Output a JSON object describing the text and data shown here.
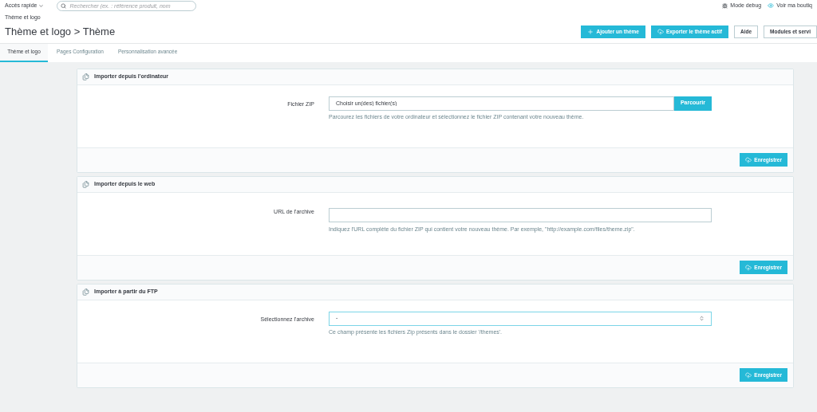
{
  "topbar": {
    "quick_access": "Accès rapide",
    "search_placeholder": "Rechercher (ex. : référence produit, nom",
    "debug": "Mode debug",
    "shop": "Voir ma boutiq"
  },
  "breadcrumb": "Thème et logo",
  "title": "Thème et logo > Thème",
  "actions": [
    {
      "label": "Ajouter un thème",
      "kind": "add"
    },
    {
      "label": "Exporter le thème actif",
      "kind": "export"
    },
    {
      "label": "Aide",
      "kind": "plain"
    },
    {
      "label": "Modules et servi",
      "kind": "plain"
    }
  ],
  "tabs": [
    {
      "label": "Thème et logo",
      "selected": true
    },
    {
      "label": "Pages Configuration",
      "selected": false
    },
    {
      "label": "Personnalisation avancée",
      "selected": false
    }
  ],
  "panels": [
    {
      "title": "Importer depuis l'ordinateur",
      "field": {
        "kind": "file",
        "label": "Fichier ZIP",
        "value": "Choisir un(des) fichier(s)",
        "button": "Parcourir",
        "help": "Parcourez les fichiers de votre ordinateur et sélectionnez le fichier ZIP contenant votre nouveau thème."
      },
      "save": "Enregistrer"
    },
    {
      "title": "Importer depuis le web",
      "field": {
        "kind": "text",
        "label": "URL de l'archive",
        "help": "Indiquez l'URL complète du fichier ZIP qui contient votre nouveau thème. Par exemple, \"http://example.com/files/theme.zip\"."
      },
      "save": "Enregistrer"
    },
    {
      "title": "Importer à partir du FTP",
      "field": {
        "kind": "select",
        "label": "Sélectionnez l'archive",
        "value": "-",
        "help": "Ce champ présente les fichiers Zip présents dans le dossier '/themes'."
      },
      "save": "Enregistrer"
    }
  ]
}
